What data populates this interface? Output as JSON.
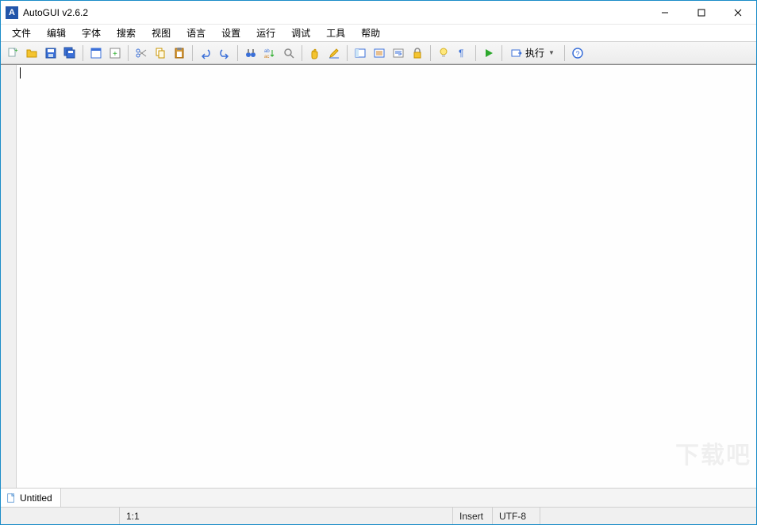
{
  "window": {
    "app_icon_letter": "A",
    "title": "AutoGUI v2.6.2"
  },
  "menu": {
    "items": [
      "文件",
      "编辑",
      "字体",
      "搜索",
      "视图",
      "语言",
      "设置",
      "运行",
      "调试",
      "工具",
      "帮助"
    ]
  },
  "toolbar": {
    "execute_label": "执行"
  },
  "tab": {
    "filename": "Untitled"
  },
  "status": {
    "position": "1:1",
    "insert_mode": "Insert",
    "encoding": "UTF-8"
  },
  "watermark": "下载吧"
}
